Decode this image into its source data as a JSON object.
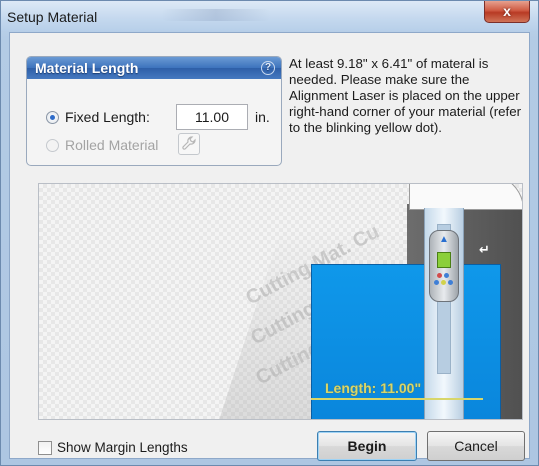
{
  "window": {
    "title": "Setup Material",
    "close_label": "x"
  },
  "material_length": {
    "header": "Material Length",
    "help_icon": "?",
    "fixed_length_label": "Fixed Length:",
    "fixed_length_value": "11.00",
    "unit": "in.",
    "rolled_material_label": "Rolled Material",
    "selected": "fixed"
  },
  "info_text": "At least 9.18\" x 6.41\" of materal is needed. Please make sure the Alignment Laser is placed on the upper right-hand corner of your material (refer to the blinking yellow dot).",
  "preview": {
    "length_label": "Length: 11.00\"",
    "ghost_text": "Cutting Mat. Cu"
  },
  "footer": {
    "show_margin_label": "Show Margin Lengths",
    "show_margin_checked": false,
    "begin_label": "Begin",
    "cancel_label": "Cancel"
  },
  "colors": {
    "accent": "#3d73bd",
    "material": "#0f98ea",
    "length_line": "#d8d66a",
    "laser_green": "#8bcf3a"
  }
}
